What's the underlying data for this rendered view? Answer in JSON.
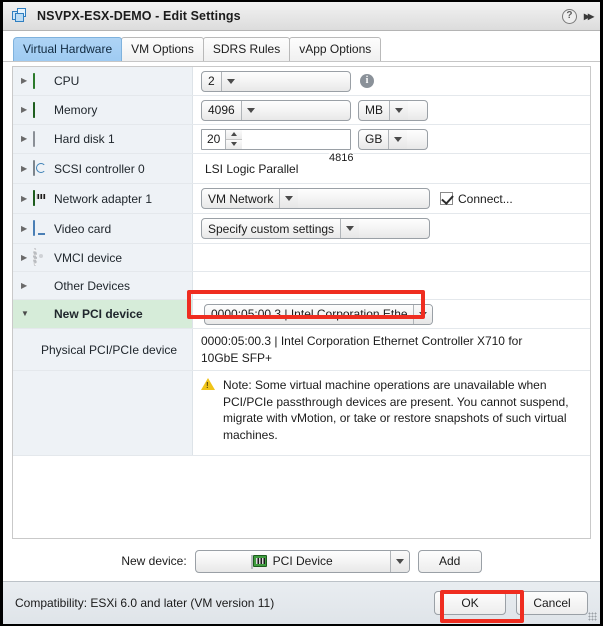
{
  "window": {
    "title": "NSVPX-ESX-DEMO - Edit Settings",
    "icon": "vm-stack-icon",
    "help_label": "?",
    "expand_label": "▸▸"
  },
  "tabs": [
    {
      "label": "Virtual Hardware",
      "active": true
    },
    {
      "label": "VM Options",
      "active": false
    },
    {
      "label": "SDRS Rules",
      "active": false
    },
    {
      "label": "vApp Options",
      "active": false
    }
  ],
  "rows": {
    "cpu": {
      "label": "CPU",
      "value": "2",
      "info_glyph": "i"
    },
    "memory": {
      "label": "Memory",
      "value": "4096",
      "unit": "MB"
    },
    "harddisk": {
      "label": "Hard disk 1",
      "value": "20",
      "unit": "GB"
    },
    "scsi": {
      "label": "SCSI controller 0",
      "value": "LSI Logic Parallel"
    },
    "network": {
      "label": "Network adapter 1",
      "value": "VM Network",
      "connect_label": "Connect...",
      "connect_checked": true
    },
    "video": {
      "label": "Video card",
      "value": "Specify custom settings"
    },
    "vmci": {
      "label": "VMCI device",
      "value": ""
    },
    "other": {
      "label": "Other Devices",
      "value": ""
    },
    "newpci": {
      "label": "New PCI device",
      "value": "0000:05:00.3 | Intel Corporation Ethe"
    },
    "physical": {
      "label": "Physical PCI/PCIe device",
      "value": "0000:05:00.3 | Intel Corporation Ethernet Controller X710 for 10GbE SFP+"
    },
    "note": {
      "label": "",
      "text": "Note: Some virtual machine operations are unavailable when PCI/PCIe passthrough devices are present. You cannot suspend, migrate with vMotion, or take or restore snapshots of such virtual machines."
    }
  },
  "overlay": {
    "tooltip_value": "4816"
  },
  "new_device": {
    "label": "New device:",
    "selected": "PCI Device",
    "icon": "pci-card-icon",
    "add_label": "Add"
  },
  "footer": {
    "compatibility": "Compatibility: ESXi 6.0 and later (VM version 11)",
    "ok_label": "OK",
    "cancel_label": "Cancel"
  },
  "colors": {
    "accent_tab": "#a6d0f2",
    "highlight_red": "#ef2d20",
    "row_header_bg": "#eef2f6",
    "selected_row_bg": "#d6ecd9"
  }
}
